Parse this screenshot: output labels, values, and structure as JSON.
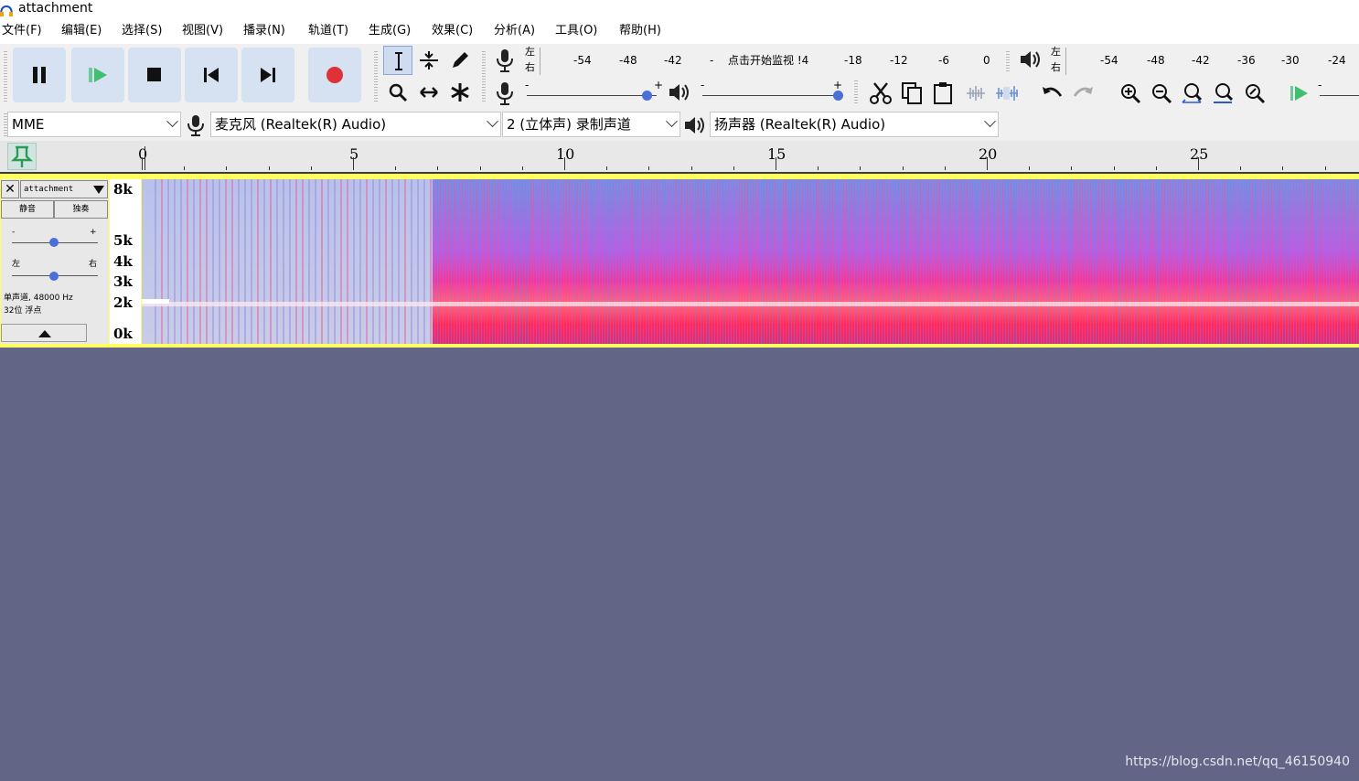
{
  "window": {
    "title": "attachment"
  },
  "menu": [
    "文件(F)",
    "编辑(E)",
    "选择(S)",
    "视图(V)",
    "播录(N)",
    "轨道(T)",
    "生成(G)",
    "效果(C)",
    "分析(A)",
    "工具(O)",
    "帮助(H)"
  ],
  "record_meter": {
    "channel_top": "左",
    "channel_bottom": "右",
    "ticks": [
      "-54",
      "-48",
      "-42",
      "-",
      "-18",
      "-12",
      "-6",
      "0"
    ],
    "monitor_label": "点击开始监视 !4"
  },
  "playback_meter": {
    "channel_top": "左",
    "channel_bottom": "右",
    "ticks": [
      "-54",
      "-48",
      "-42",
      "-36",
      "-30",
      "-24"
    ]
  },
  "mixer": {
    "rec_minus": "-",
    "rec_plus": "+",
    "play_minus": "-",
    "play_plus": "+"
  },
  "devices": {
    "host": "MME",
    "recording_device": "麦克风 (Realtek(R) Audio)",
    "channels": "2 (立体声) 录制声道",
    "playback_device": "扬声器 (Realtek(R) Audio)"
  },
  "ruler": {
    "labels": [
      "0",
      "5",
      "10",
      "15",
      "20",
      "25"
    ]
  },
  "track": {
    "name": "attachment",
    "mute": "静音",
    "solo": "独奏",
    "gain_minus": "-",
    "gain_plus": "+",
    "pan_left": "左",
    "pan_right": "右",
    "info_line1": "单声道, 48000 Hz",
    "info_line2": "32位 浮点",
    "freq_labels": [
      "8k",
      "5k",
      "4k",
      "3k",
      "2k",
      "0k"
    ]
  },
  "colors": {
    "track_bg": "#626586",
    "button_bg": "#d6e1f2",
    "selection_border": "#ffff60",
    "play_green": "#3fbf6f",
    "record_red": "#e0303a"
  },
  "watermark": "https://blog.csdn.net/qq_46150940"
}
